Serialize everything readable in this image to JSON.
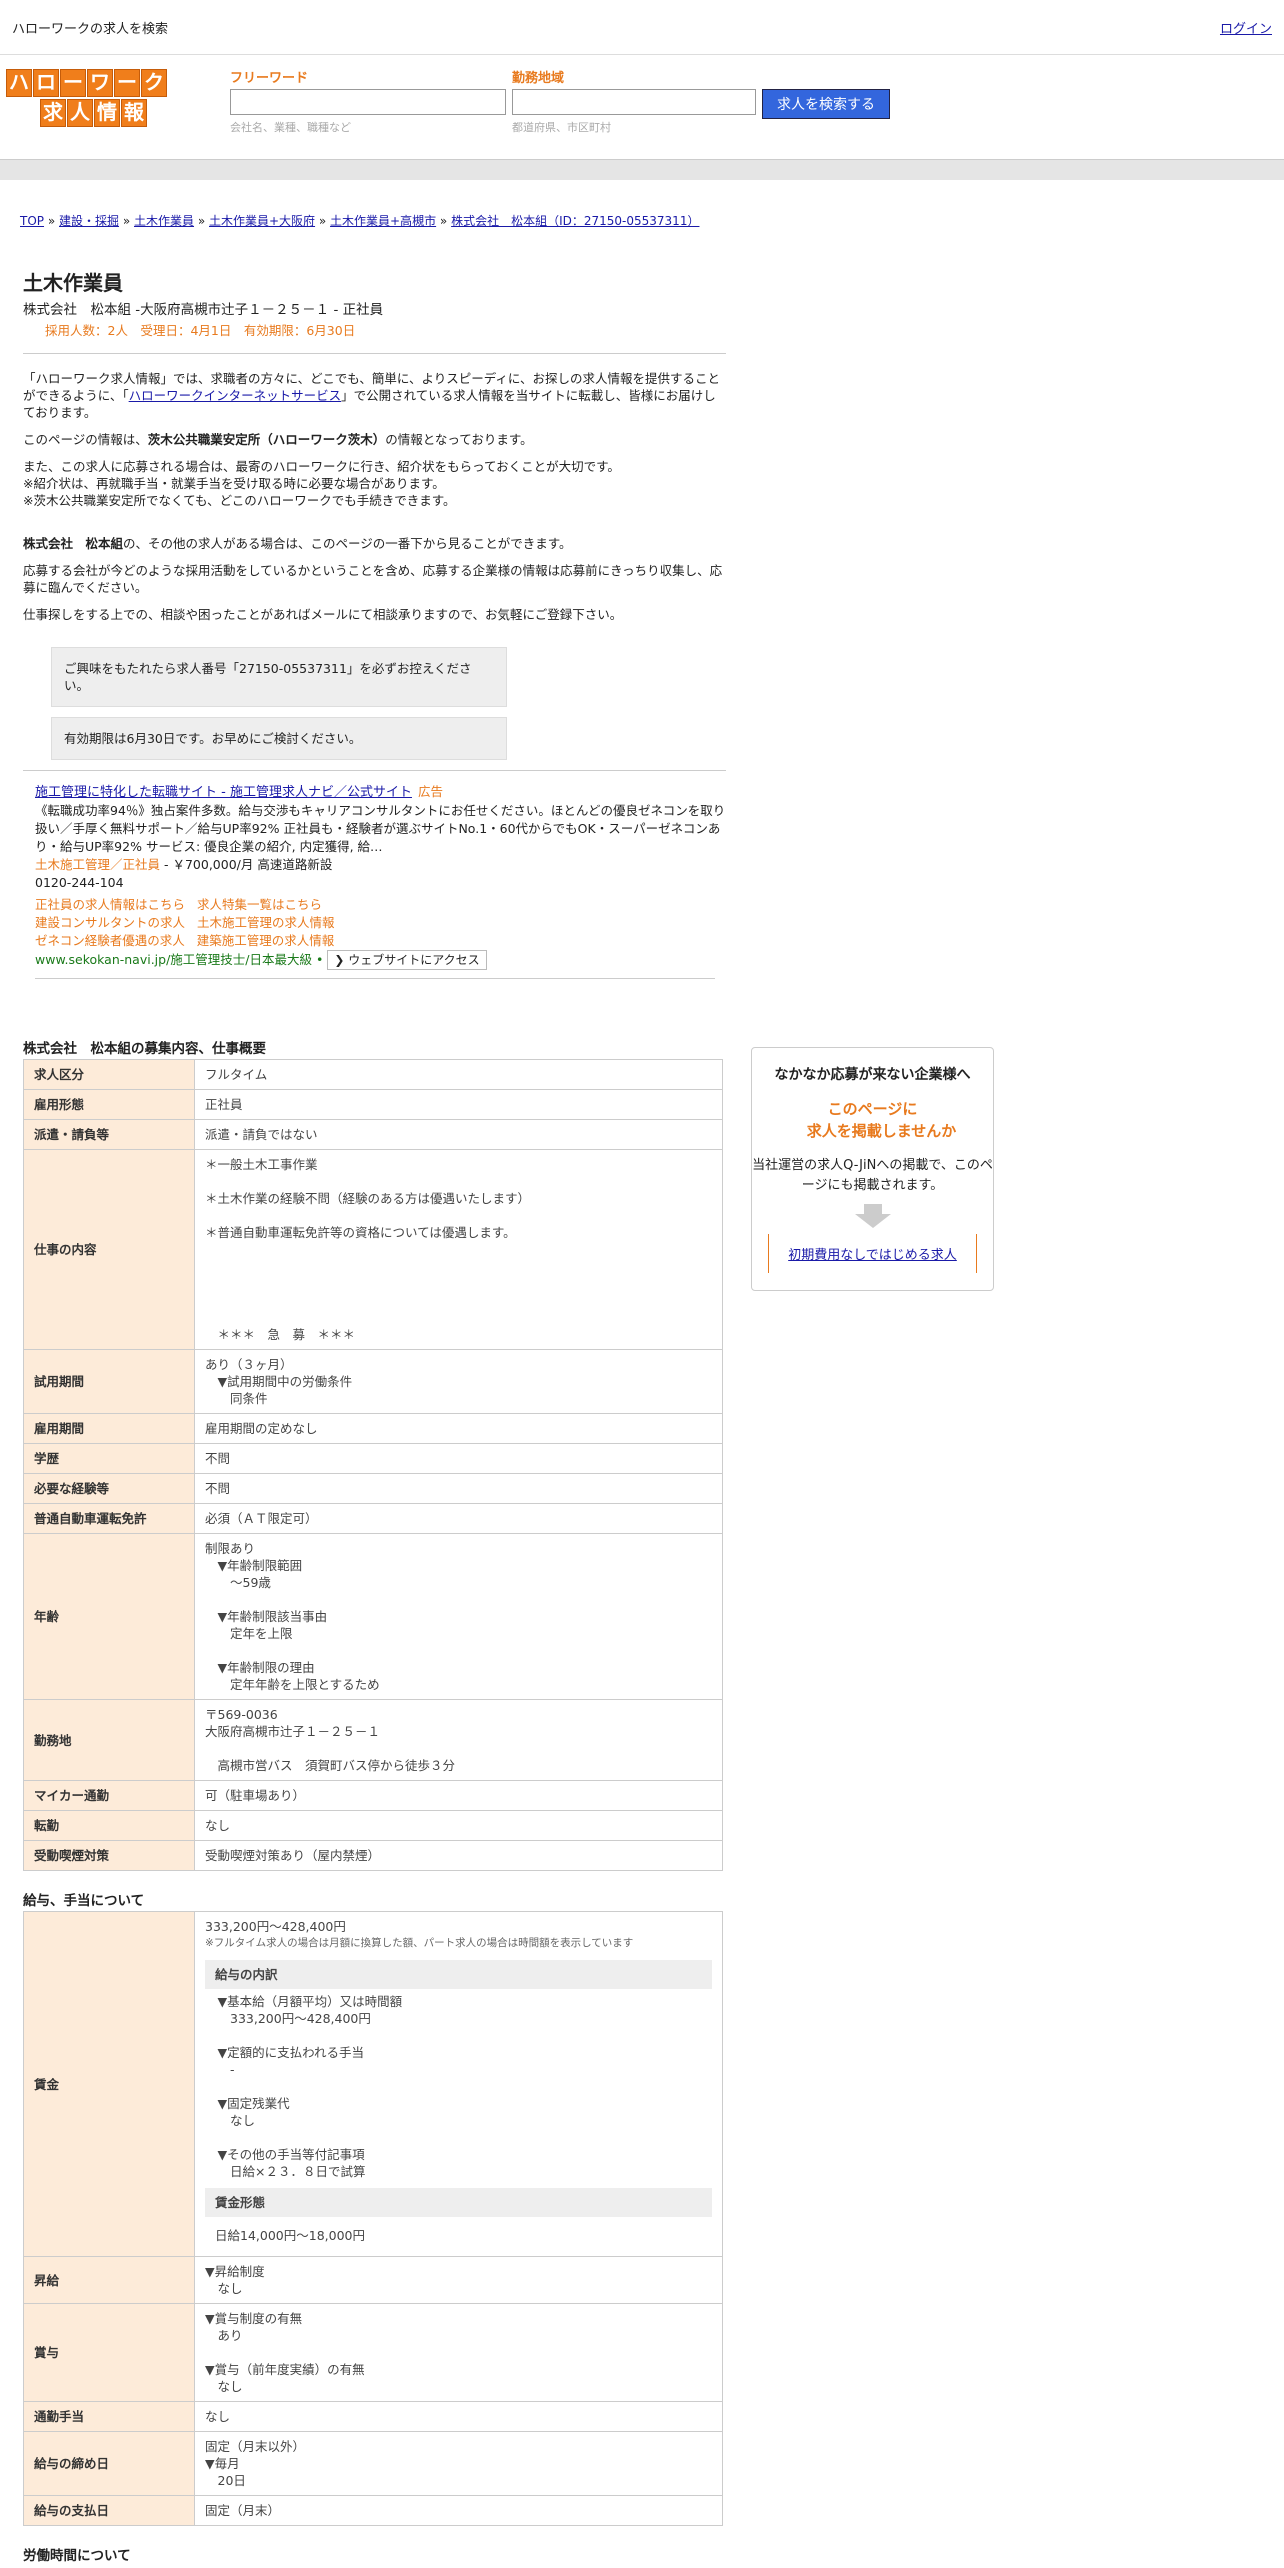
{
  "topbar": {
    "title": "ハローワークの求人を検索",
    "login": "ログイン"
  },
  "logo": {
    "row1": [
      "ハ",
      "ロ",
      "ー",
      "ワ",
      "ー",
      "ク"
    ],
    "row2": [
      "求",
      "人",
      "情",
      "報"
    ]
  },
  "search": {
    "freeword_label": "フリーワード",
    "freeword_placeholder": "会社名、業種、職種など",
    "area_label": "勤務地域",
    "area_placeholder": "都道府県、市区町村",
    "button": "求人を検索する"
  },
  "breadcrumb": [
    "TOP",
    "建設・採掘",
    "土木作業員",
    "土木作業員+大阪府",
    "土木作業員+高槻市",
    "株式会社　松本組（ID：27150-05537311）"
  ],
  "job": {
    "title": "土木作業員",
    "subtitle": "株式会社　松本組 -大阪府高槻市辻子１－２５－１ - 正社員",
    "meta": "採用人数：2人　受理日：4月1日　有効期限：6月30日"
  },
  "intro": {
    "p1a": "「ハローワーク求人情報」では、求職者の方々に、どこでも、簡単に、よりスピーディに、お探しの求人情報を提供することができるように、「",
    "p1link": "ハローワークインターネットサービス",
    "p1b": "」で公開されている求人情報を当サイトに転載し、皆様にお届けしております。",
    "p2a": "このページの情報は、",
    "p2b": "茨木公共職業安定所（ハローワーク茨木）",
    "p2c": "の情報となっております。",
    "p3": "また、この求人に応募される場合は、最寄のハローワークに行き、紹介状をもらっておくことが大切です。",
    "p4": "※紹介状は、再就職手当・就業手当を受け取る時に必要な場合があります。",
    "p5": "※茨木公共職業安定所でなくても、どこのハローワークでも手続きできます。",
    "p6a": "株式会社　松本組",
    "p6b": "の、その他の求人がある場合は、このページの一番下から見ることができます。",
    "p7": "応募する会社が今どのような採用活動をしているかということを含め、応募する企業様の情報は応募前にきっちり収集し、応募に臨んでください。",
    "p8": "仕事探しをする上での、相談や困ったことがあればメールにて相談承りますので、お気軽にご登録下さい。"
  },
  "notices": [
    "ご興味をもたれたら求人番号「27150-05537311」を必ずお控えください。",
    "有効期限は6月30日です。お早めにご検討ください。"
  ],
  "ad": {
    "title": "施工管理に特化した転職サイト - 施工管理求人ナビ／公式サイト",
    "tag": "広告",
    "desc": "《転職成功率94％》独占案件多数。給与交渉もキャリアコンサルタントにお任せください。ほとんどの優良ゼネコンを取り扱い／手厚く無料サポート／給与UP率92% 正社員も・経験者が選ぶサイトNo.1・60代からでもOK・スーパーゼネコンあり・給与UP率92% サービス: 優良企業の紹介, 内定獲得, 給…",
    "line1_orange": "土木施工管理／正社員",
    "line1_rest": " - ￥700,000/月 高速道路新設",
    "phone": "0120-244-104",
    "links": [
      [
        "正社員の求人情報はこちら",
        "求人特集一覧はこちら"
      ],
      [
        "建設コンサルタントの求人",
        "土木施工管理の求人情報"
      ],
      [
        "ゼネコン経験者優遇の求人",
        "建築施工管理の求人情報"
      ]
    ],
    "url": "www.sekokan-navi.jp/施工管理技士/日本最大級",
    "site_button": "❯ ウェブサイトにアクセス"
  },
  "section1": {
    "title": "株式会社　松本組の募集内容、仕事概要",
    "rows": [
      {
        "k": "求人区分",
        "v": "フルタイム"
      },
      {
        "k": "雇用形態",
        "v": "正社員"
      },
      {
        "k": "派遣・請負等",
        "v": "派遣・請負ではない"
      },
      {
        "k": "仕事の内容",
        "v": "＊一般土木工事作業\n\n＊土木作業の経験不問（経験のある方は優遇いたします）\n\n＊普通自動車運転免許等の資格については優遇します。\n\n\n\n\n\n　＊＊＊　急　募　＊＊＊"
      },
      {
        "k": "試用期間",
        "v": "あり（３ヶ月）\n　▼試用期間中の労働条件\n　　同条件"
      },
      {
        "k": "雇用期間",
        "v": "雇用期間の定めなし"
      },
      {
        "k": "学歴",
        "v": "不問"
      },
      {
        "k": "必要な経験等",
        "v": "不問"
      },
      {
        "k": "普通自動車運転免許",
        "v": "必須（ＡＴ限定可）"
      },
      {
        "k": "年齢",
        "v": "制限あり\n　▼年齢制限範囲\n　　〜59歳\n\n　▼年齢制限該当事由\n　　定年を上限\n\n　▼年齢制限の理由\n　　定年年齢を上限とするため"
      },
      {
        "k": "勤務地",
        "v": "〒569-0036\n大阪府高槻市辻子１－２５－１\n\n　高槻市営バス　須賀町バス停から徒歩３分"
      },
      {
        "k": "マイカー通勤",
        "v": "可（駐車場あり）"
      },
      {
        "k": "転勤",
        "v": "なし"
      },
      {
        "k": "受動喫煙対策",
        "v": "受動喫煙対策あり（屋内禁煙）"
      }
    ]
  },
  "side": {
    "heading": "なかなか応募が来ない企業様へ",
    "orange1": "このページに",
    "orange2": "求人を掲載しませんか",
    "text": "当社運営の求人Q-JiNへの掲載で、このページにも掲載されます。",
    "link": "初期費用なしではじめる求人"
  },
  "section2": {
    "title": "給与、手当について",
    "wage_range": "333,200円〜428,400円",
    "wage_note": "※フルタイム求人の場合は月額に換算した額、パート求人の場合は時間額を表示しています",
    "breakdown_title": "給与の内訳",
    "breakdown": "　▼基本給（月額平均）又は時間額\n　　333,200円〜428,400円\n\n　▼定額的に支払われる手当\n　　-\n\n　▼固定残業代\n　　なし\n\n　▼その他の手当等付記事項\n　　日給×２３．８日で試算",
    "form_title": "賃金形態",
    "form_value": "日給14,000円〜18,000円",
    "rows": [
      {
        "k": "昇給",
        "v": "▼昇給制度\n　なし"
      },
      {
        "k": "賞与",
        "v": "▼賞与制度の有無\n　あり\n\n▼賞与（前年度実績）の有無\n　なし"
      },
      {
        "k": "通勤手当",
        "v": "なし"
      },
      {
        "k": "給与の締め日",
        "v": "固定（月末以外）\n▼毎月\n　20日"
      },
      {
        "k": "給与の支払日",
        "v": "固定（月末）"
      }
    ],
    "wage_key": "賃金"
  },
  "section3": {
    "title": "労働時間について"
  }
}
